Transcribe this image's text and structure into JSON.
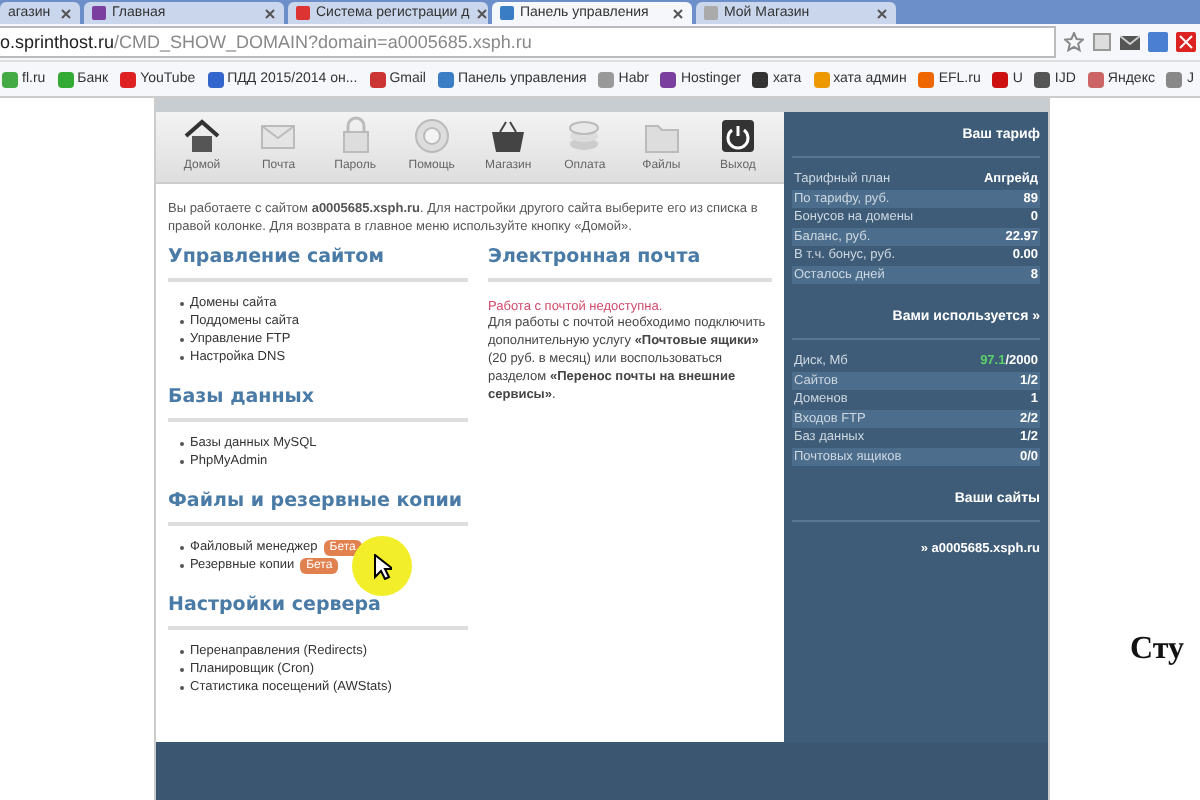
{
  "browser": {
    "tabs": [
      {
        "title": "агазин",
        "selected": false
      },
      {
        "title": "Главная",
        "selected": false
      },
      {
        "title": "Система регистрации д",
        "selected": false
      },
      {
        "title": "Панель управления",
        "selected": true
      },
      {
        "title": "Мой Магазин",
        "selected": false
      }
    ],
    "address": {
      "host": "o.sprinthost.ru",
      "path": "/CMD_SHOW_DOMAIN?domain=a0005685.xsph.ru"
    },
    "bookmarks": [
      "fl.ru",
      "Банк",
      "YouTube",
      "ПДД 2015/2014 он...",
      "Gmail",
      "Панель управления",
      "Habr",
      "Hostinger",
      "хата",
      "хата админ",
      "EFL.ru",
      "U",
      "IJD",
      "Яндекс",
      "J"
    ]
  },
  "toolbar": [
    {
      "kind": "home",
      "label": "Домой"
    },
    {
      "kind": "mail",
      "label": "Почта"
    },
    {
      "kind": "lock",
      "label": "Пароль"
    },
    {
      "kind": "help",
      "label": "Помощь"
    },
    {
      "kind": "shop",
      "label": "Магазин"
    },
    {
      "kind": "pay",
      "label": "Оплата"
    },
    {
      "kind": "files",
      "label": "Файлы"
    },
    {
      "kind": "exit",
      "label": "Выход"
    }
  ],
  "intro": "Вы работаете с сайтом **a0005685.xsph.ru**. Для настройки другого сайта выберите его из списка в правой колонке. Для возврата в главное меню используйте кнопку «Домой».",
  "left_sections": [
    {
      "title": "Управление сайтом",
      "items": [
        {
          "label": "Домены сайта"
        },
        {
          "label": "Поддомены сайта"
        },
        {
          "label": "Управление FTP"
        },
        {
          "label": "Настройка DNS"
        }
      ]
    },
    {
      "title": "Базы данных",
      "items": [
        {
          "label": "Базы данных MySQL"
        },
        {
          "label": "PhpMyAdmin"
        }
      ]
    },
    {
      "title": "Файлы и резервные копии",
      "items": [
        {
          "label": "Файловый менеджер",
          "badge": "Бета"
        },
        {
          "label": "Резервные копии",
          "badge": "Бета"
        }
      ]
    },
    {
      "title": "Настройки сервера",
      "items": [
        {
          "label": "Перенаправления (Redirects)"
        },
        {
          "label": "Планировщик (Cron)"
        },
        {
          "label": "Статистика посещений (AWStats)"
        }
      ]
    }
  ],
  "email": {
    "title": "Электронная почта",
    "warning": "Работа с почтой недоступна.",
    "text": "Для работы с почтой необходимо подключить дополнительную услугу **«Почтовые ящики»** (20 руб. в месяц) или воспользоваться разделом **«Перенос почты на внешние сервисы»**."
  },
  "sidebar": {
    "tariff_title": "Ваш тариф",
    "tariff": [
      {
        "label": "Тарифный план",
        "value": "Апгрейд"
      },
      {
        "label": "По тарифу, руб.",
        "value": "89"
      },
      {
        "label": "Бонусов на домены",
        "value": "0"
      },
      {
        "label": "Баланс, руб.",
        "value": "22.97"
      },
      {
        "label": "В т.ч. бонус, руб.",
        "value": "0.00"
      },
      {
        "label": "Осталось дней",
        "value": "8"
      }
    ],
    "usage_title": "Вами используется »",
    "usage": [
      {
        "label": "Диск, Мб",
        "used": "97.1",
        "value": "/2000"
      },
      {
        "label": "Сайтов",
        "value": "1/2"
      },
      {
        "label": "Доменов",
        "value": "1"
      },
      {
        "label": "Входов FTP",
        "value": "2/2"
      },
      {
        "label": "Баз данных",
        "value": "1/2"
      },
      {
        "label": "Почтовых ящиков",
        "value": "0/0"
      }
    ],
    "sites_title": "Ваши сайты",
    "sites": [
      "» a0005685.xsph.ru"
    ]
  },
  "side_caption": "Сту"
}
